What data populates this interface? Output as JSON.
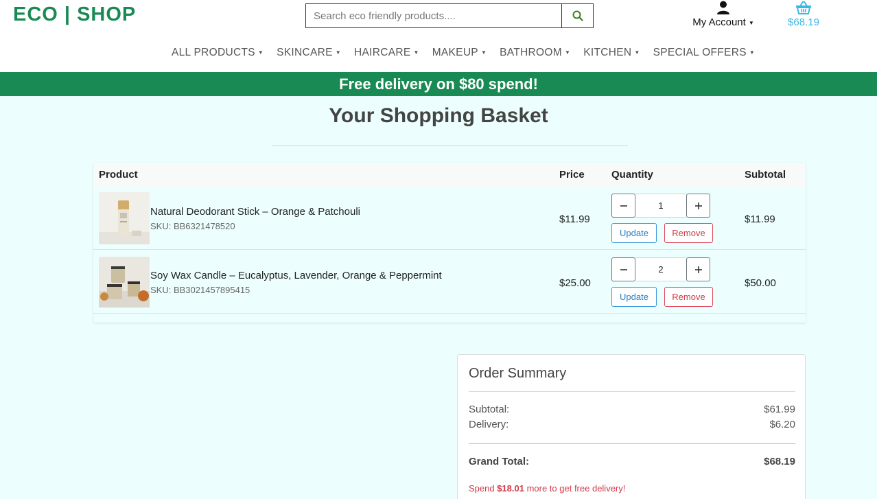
{
  "header": {
    "logo": "ECO | SHOP",
    "search": {
      "placeholder": "Search eco friendly products...."
    },
    "account_label": "My Account",
    "basket_total": "$68.19"
  },
  "nav": {
    "items": [
      {
        "label": "ALL PRODUCTS"
      },
      {
        "label": "SKINCARE"
      },
      {
        "label": "HAIRCARE"
      },
      {
        "label": "MAKEUP"
      },
      {
        "label": "BATHROOM"
      },
      {
        "label": "KITCHEN"
      },
      {
        "label": "SPECIAL OFFERS"
      }
    ]
  },
  "promo": "Free delivery on $80 spend!",
  "page_title": "Your Shopping Basket",
  "cart": {
    "columns": {
      "product": "Product",
      "price": "Price",
      "quantity": "Quantity",
      "subtotal": "Subtotal"
    },
    "items": [
      {
        "name": "Natural Deodorant Stick – Orange & Patchouli",
        "sku": "SKU: BB6321478520",
        "price": "$11.99",
        "quantity": "1",
        "subtotal": "$11.99",
        "update_label": "Update",
        "remove_label": "Remove"
      },
      {
        "name": "Soy Wax Candle – Eucalyptus, Lavender, Orange & Peppermint",
        "sku": "SKU: BB3021457895415",
        "price": "$25.00",
        "quantity": "2",
        "subtotal": "$50.00",
        "update_label": "Update",
        "remove_label": "Remove"
      }
    ]
  },
  "summary": {
    "title": "Order Summary",
    "subtotal_label": "Subtotal:",
    "subtotal_value": "$61.99",
    "delivery_label": "Delivery:",
    "delivery_value": "$6.20",
    "grand_label": "Grand Total:",
    "grand_value": "$68.19",
    "note_prefix": "Spend ",
    "note_amount": "$18.01",
    "note_suffix": " more to get free delivery!"
  },
  "colors": {
    "brand_green": "#1a8a55",
    "basket_blue": "#3cb6e3",
    "page_bg": "#ecfffe",
    "remove_red": "#d03a4b",
    "update_blue": "#2a7fc1"
  },
  "icons": {
    "search": "search-icon",
    "account": "user-icon",
    "basket": "basket-icon",
    "minus": "minus-icon",
    "plus": "plus-icon"
  }
}
